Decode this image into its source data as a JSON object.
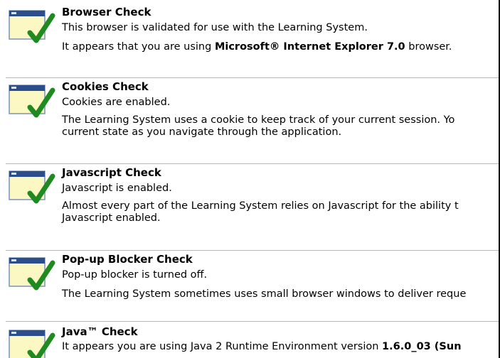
{
  "checks": [
    {
      "title": "Browser Check",
      "status": "This browser is validated for use with the Learning System.",
      "detail_prefix": "It appears that you are using ",
      "detail_bold": "Microsoft® Internet Explorer 7.0",
      "detail_suffix": " browser.",
      "icon": "check-icon"
    },
    {
      "title": "Cookies Check",
      "status": "Cookies are enabled.",
      "detail_line1": "The Learning System uses a cookie to keep track of your current session. Yo",
      "detail_line2": "current state as you navigate through the application.",
      "icon": "check-icon"
    },
    {
      "title": "Javascript Check",
      "status": "Javascript is enabled.",
      "detail_line1": "Almost every part of the Learning System relies on Javascript for the ability t",
      "detail_line2": "Javascript enabled.",
      "icon": "check-icon"
    },
    {
      "title": "Pop-up Blocker Check",
      "status": "Pop-up blocker is turned off.",
      "detail_line1": "The Learning System sometimes uses small browser windows to deliver reque",
      "icon": "check-icon"
    },
    {
      "title": "Java™ Check",
      "detail_prefix": "It appears you are using Java 2 Runtime Environment version ",
      "detail_bold": "1.6.0_03 (Sun",
      "icon": "check-icon"
    }
  ],
  "colors": {
    "check_green": "#1f8a1f",
    "window_blue": "#2b4d8c",
    "window_fill": "#fbf8c4",
    "divider": "#b8b8b8"
  }
}
